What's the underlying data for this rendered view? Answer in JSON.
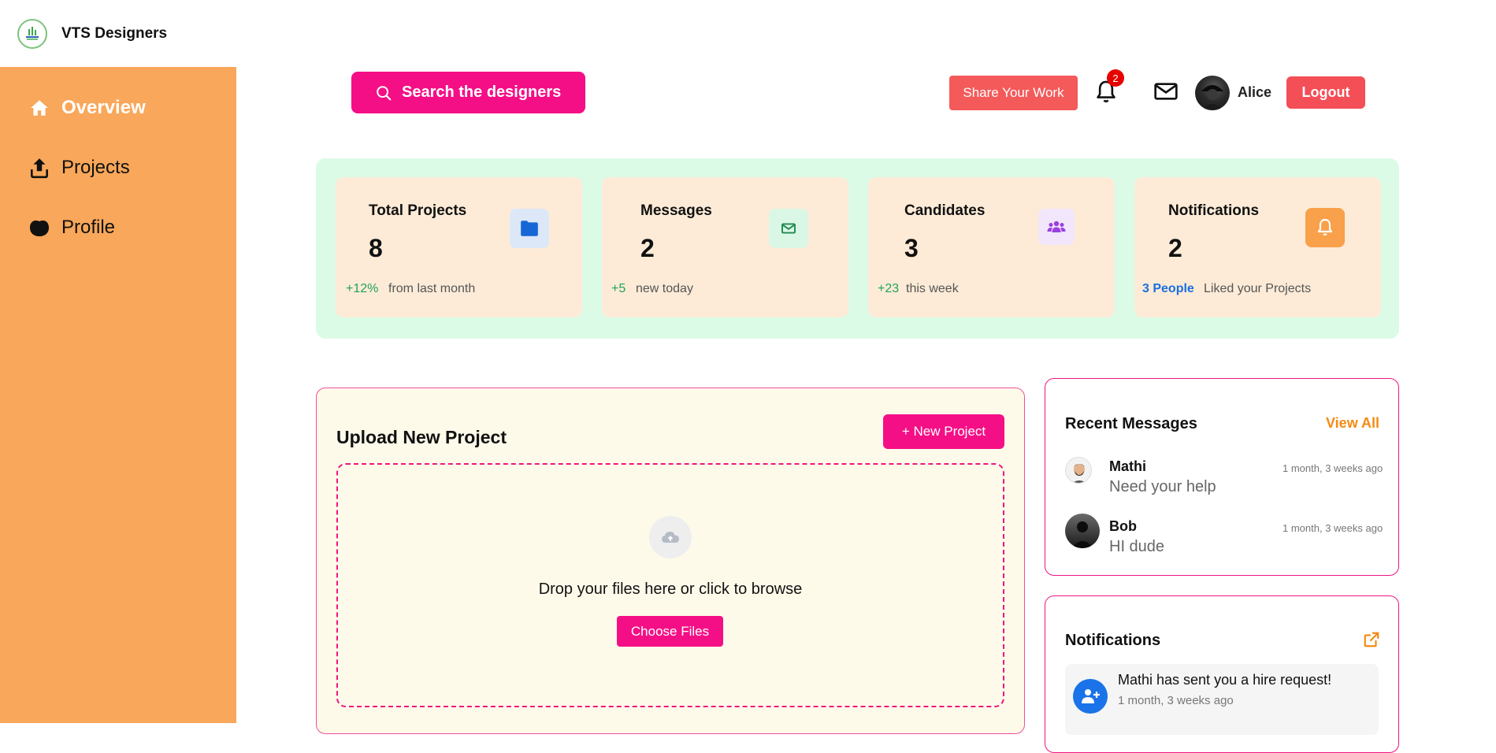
{
  "brand": {
    "name": "VTS Designers"
  },
  "sidebar": {
    "items": [
      {
        "label": "Overview",
        "icon": "home-icon"
      },
      {
        "label": "Projects",
        "icon": "upload-icon"
      },
      {
        "label": "Profile",
        "icon": "profile-blob-icon"
      }
    ]
  },
  "header": {
    "search_label": "Search the designers",
    "share_label": "Share Your Work",
    "notification_count": "2",
    "username": "Alice",
    "logout_label": "Logout"
  },
  "stats": [
    {
      "title": "Total Projects",
      "value": "8",
      "delta": "+12%",
      "note": "from last month",
      "icon": "folder-icon",
      "icon_bg": "#dce8f8",
      "icon_color": "#1766d6"
    },
    {
      "title": "Messages",
      "value": "2",
      "delta": "+5",
      "note": "new today",
      "icon": "mail-icon",
      "icon_bg": "#daf7e5",
      "icon_color": "#1e8a4e"
    },
    {
      "title": "Candidates",
      "value": "3",
      "delta": "+23",
      "note": "this week",
      "icon": "users-icon",
      "icon_bg": "#f1e6fb",
      "icon_color": "#9b3fe0"
    },
    {
      "title": "Notifications",
      "value": "2",
      "delta": "3 People",
      "note": "Liked your Projects",
      "icon": "bell-icon",
      "icon_bg": "#f9a04a",
      "icon_color": "#ffffff"
    }
  ],
  "upload": {
    "title": "Upload New Project",
    "new_project_label": "+ New Project",
    "drop_text": "Drop your files here or click to browse",
    "choose_label": "Choose Files"
  },
  "recent_messages": {
    "title": "Recent Messages",
    "view_all": "View All",
    "items": [
      {
        "name": "Mathi",
        "time": "1 month, 3 weeks ago",
        "text": "Need your help"
      },
      {
        "name": "Bob",
        "time": "1 month, 3 weeks ago",
        "text": "HI dude"
      }
    ]
  },
  "notifications": {
    "title": "Notifications",
    "items": [
      {
        "text": "Mathi has sent you a hire request!",
        "time": "1 month, 3 weeks ago"
      }
    ]
  },
  "colors": {
    "sidebar": "#f9a75a",
    "primary_pink": "#f50f86",
    "danger": "#f44e57",
    "stats_panel": "#dcfbe6",
    "stat_card": "#fdebd7"
  }
}
